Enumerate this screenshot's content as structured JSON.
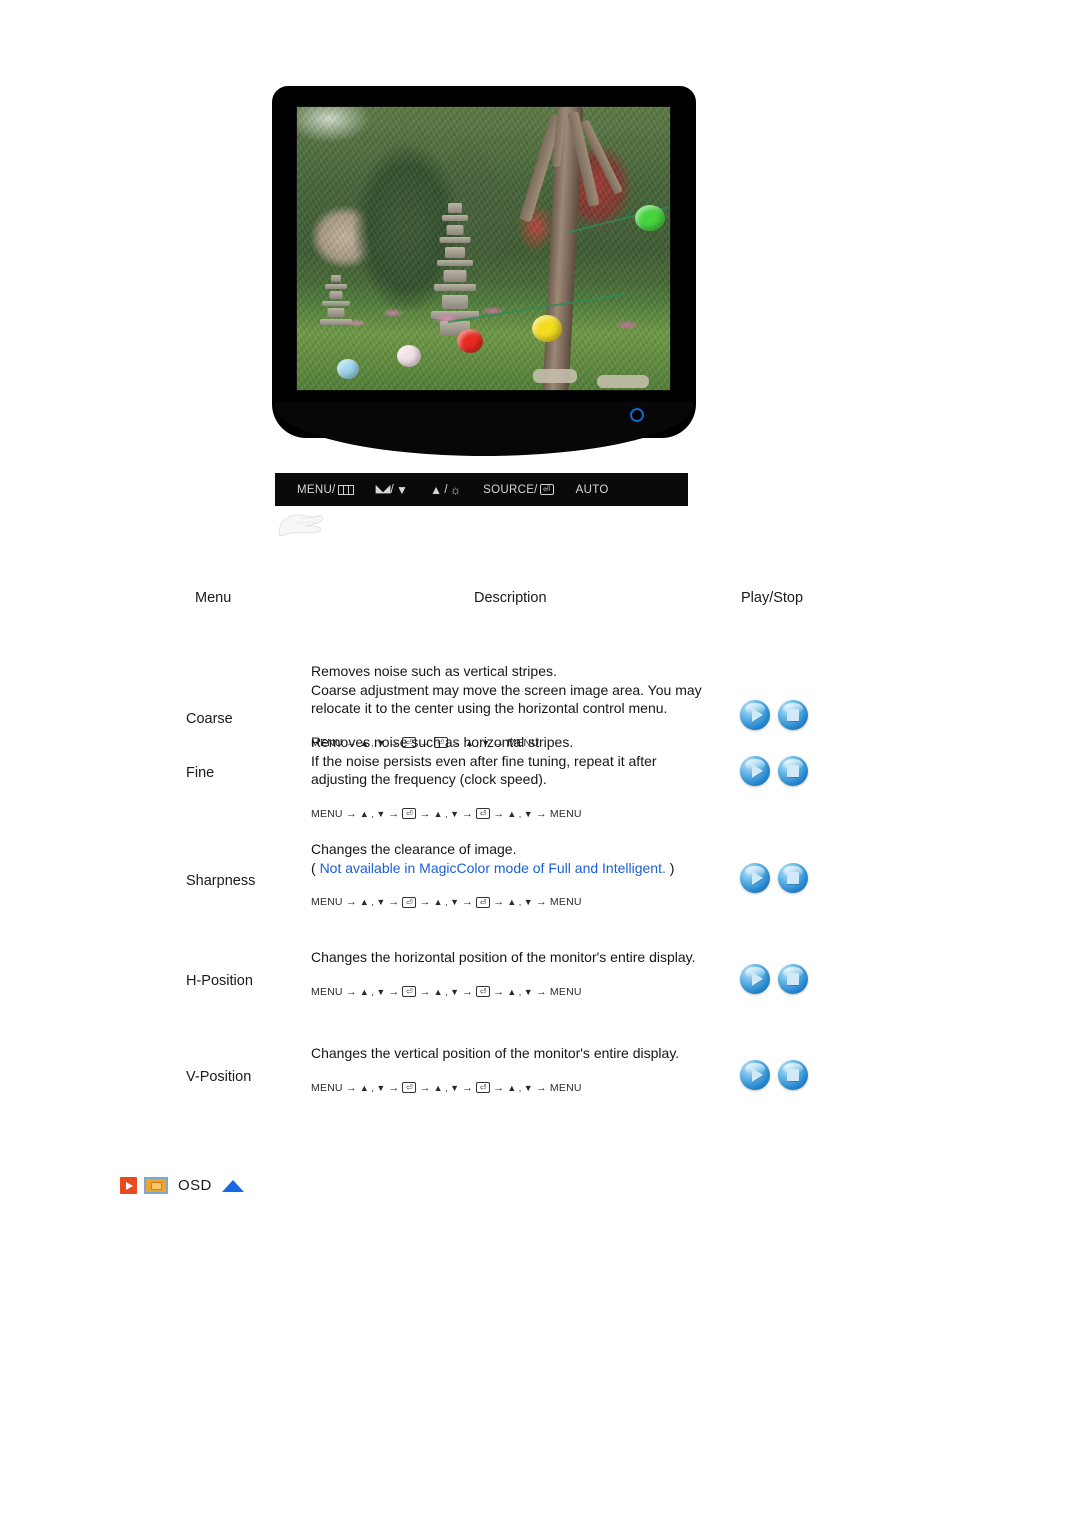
{
  "monitor": {
    "alt": "LCD monitor displaying a garden photo with stone pagoda and paper lanterns",
    "power_led": "power-led-ring",
    "control_bar": {
      "buttons": [
        {
          "name": "menu-button",
          "label": "MENU/",
          "icon": "osd-box-icon"
        },
        {
          "name": "contrast-button",
          "label": "/",
          "icon_left": "contrast-icon",
          "icon_right": "down-arrow-icon"
        },
        {
          "name": "brightness-button",
          "label": "/",
          "icon_left": "up-arrow-icon",
          "icon_right": "brightness-sun-icon"
        },
        {
          "name": "source-button",
          "label": "SOURCE/",
          "icon": "enter-key-icon"
        },
        {
          "name": "auto-button",
          "label": "AUTO",
          "icon": null
        }
      ],
      "menu_label": "MENU/",
      "source_label": "SOURCE/",
      "auto_label": "AUTO",
      "slash": "/"
    }
  },
  "table": {
    "headers": {
      "menu": "Menu",
      "description": "Description",
      "playstop": "Play/Stop"
    },
    "rows": [
      {
        "menu": "Coarse",
        "desc_lines": [
          "Removes noise such as vertical stripes.",
          "Coarse adjustment may move the screen image area. You may relocate it to the center using the horizontal control menu."
        ],
        "note_blue": null,
        "keyseq": [
          "MENU",
          "▲ , ▼",
          "ENTER",
          "ENTER",
          "▲ , ▼",
          "MENU"
        ],
        "play_label": "Play",
        "stop_label": "Stop"
      },
      {
        "menu": "Fine",
        "desc_lines": [
          "Removes noise such as horizontal stripes.",
          "If the noise persists even after fine tuning, repeat it after adjusting the frequency (clock speed)."
        ],
        "note_blue": null,
        "keyseq": [
          "MENU",
          "▲ , ▼",
          "ENTER",
          "▲ , ▼",
          "ENTER",
          "▲ , ▼",
          "MENU"
        ],
        "play_label": "Play",
        "stop_label": "Stop"
      },
      {
        "menu": "Sharpness",
        "desc_lines": [
          "Changes the clearance of image."
        ],
        "note_open": "( ",
        "note_blue": "Not available in MagicColor mode of Full and Intelligent.",
        "note_close": " )",
        "keyseq": [
          "MENU",
          "▲ , ▼",
          "ENTER",
          "▲ , ▼",
          "ENTER",
          "▲ , ▼",
          "MENU"
        ],
        "play_label": "Play",
        "stop_label": "Stop"
      },
      {
        "menu": "H-Position",
        "desc_lines": [
          "Changes the horizontal position of the monitor's entire display."
        ],
        "note_blue": null,
        "keyseq": [
          "MENU",
          "▲ , ▼",
          "ENTER",
          "▲ , ▼",
          "ENTER",
          "▲ , ▼",
          "MENU"
        ],
        "play_label": "Play",
        "stop_label": "Stop"
      },
      {
        "menu": "V-Position",
        "desc_lines": [
          "Changes the vertical position of the monitor's entire display."
        ],
        "note_blue": null,
        "keyseq": [
          "MENU",
          "▲ , ▼",
          "ENTER",
          "▲ , ▼",
          "ENTER",
          "▲ , ▼",
          "MENU"
        ],
        "play_label": "Play",
        "stop_label": "Stop"
      }
    ]
  },
  "footer": {
    "label": "OSD",
    "play_icon": "play-icon",
    "monitor_icon": "monitor-icon",
    "up_icon": "scroll-up-icon"
  },
  "colors": {
    "blue_note": "#1a5fd8",
    "footer_red": "#e8491d",
    "footer_orange": "#f0a32a",
    "footer_blue": "#1669e0",
    "button_blue": "#2f8fd4",
    "led_blue": "#1168c8"
  }
}
